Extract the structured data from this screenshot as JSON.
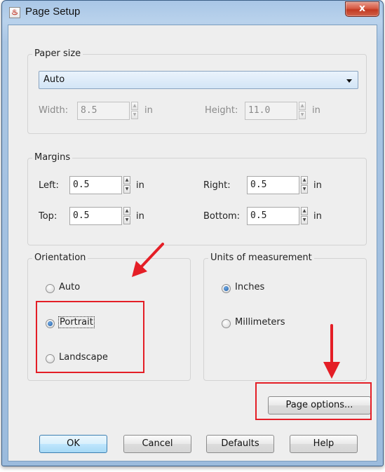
{
  "window": {
    "title": "Page Setup",
    "close_glyph": "x",
    "app_icon": "java-cup-icon",
    "app_icon_glyph": "♨"
  },
  "paper_size": {
    "group_label": "Paper size",
    "selected": "Auto",
    "width_label": "Width:",
    "width_value": "8.5",
    "width_unit": "in",
    "height_label": "Height:",
    "height_value": "11.0",
    "height_unit": "in"
  },
  "margins": {
    "group_label": "Margins",
    "left_label": "Left:",
    "left_value": "0.5",
    "right_label": "Right:",
    "right_value": "0.5",
    "top_label": "Top:",
    "top_value": "0.5",
    "bottom_label": "Bottom:",
    "bottom_value": "0.5",
    "unit": "in"
  },
  "orientation": {
    "group_label": "Orientation",
    "options": [
      {
        "label": "Auto",
        "selected": false
      },
      {
        "label": "Portrait",
        "selected": true
      },
      {
        "label": "Landscape",
        "selected": false
      }
    ]
  },
  "units": {
    "group_label": "Units of measurement",
    "options": [
      {
        "label": "Inches",
        "selected": true
      },
      {
        "label": "Millimeters",
        "selected": false
      }
    ]
  },
  "buttons": {
    "page_options": "Page options...",
    "ok": "OK",
    "cancel": "Cancel",
    "defaults": "Defaults",
    "help": "Help"
  },
  "colors": {
    "annotation_red": "#e41e26",
    "title_bar": "#a9c6e6",
    "dialog_background": "#eeeeee"
  }
}
